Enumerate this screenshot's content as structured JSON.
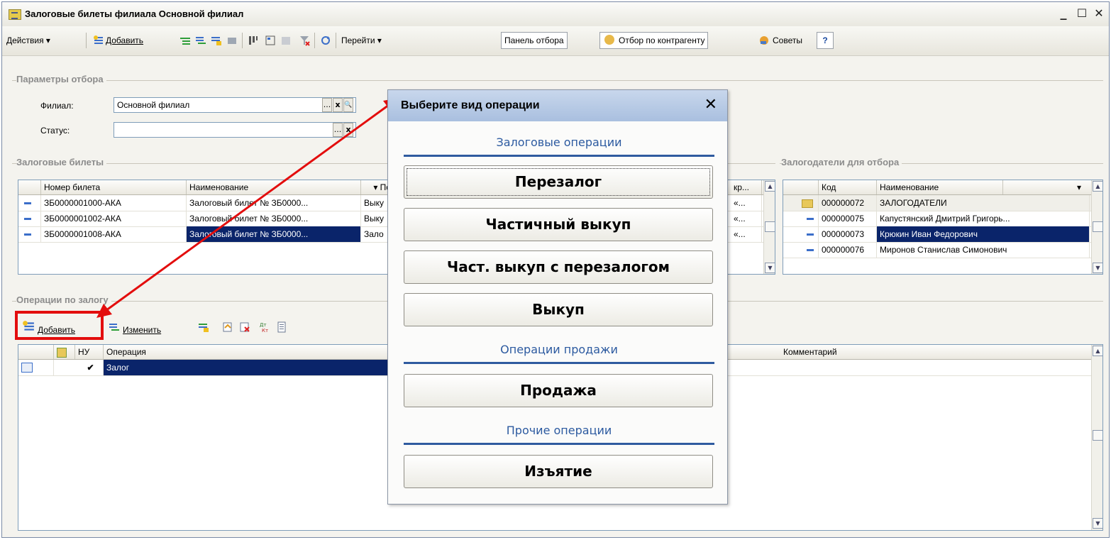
{
  "window": {
    "title": "Залоговые билеты филиала Основной филиал",
    "min": "_",
    "max": "☐",
    "close": "✕"
  },
  "toolbar": {
    "actions": "Действия ▾",
    "add": "Добавить",
    "goto": "Перейти ▾",
    "filter_panel": "Панель отбора",
    "filter_counterparty": "Отбор по контрагенту",
    "tips": "Советы",
    "help": "?"
  },
  "filter": {
    "group_title": "Параметры отбора",
    "branch_label": "Филиал:",
    "branch_value": "Основной филиал",
    "status_label": "Статус:",
    "status_value": "",
    "btn_dots": "...",
    "btn_x": "x",
    "btn_search": "🔍"
  },
  "tickets": {
    "group_title": "Залоговые билеты",
    "columns": [
      "Номер билета",
      "Наименование",
      "▾ Посл",
      "кр...",
      "^"
    ],
    "rows": [
      {
        "number": "ЗБ0000001000-АКА",
        "name": "Залоговый билет № ЗБ0000...",
        "last": "Выку",
        "extra": "«..."
      },
      {
        "number": "ЗБ0000001002-АКА",
        "name": "Залоговый билет № ЗБ0000...",
        "last": "Выку",
        "extra": "«..."
      },
      {
        "number": "ЗБ0000001008-АКА",
        "name": "Залоговый билет № ЗБ0000...",
        "last": "Зало",
        "extra": "«..."
      }
    ]
  },
  "pledgers": {
    "group_title": "Залогодатели для отбора",
    "columns": [
      "Код",
      "Наименование",
      "▾"
    ],
    "rows": [
      {
        "code": "000000072",
        "name": "ЗАЛОГОДАТЕЛИ"
      },
      {
        "code": "000000075",
        "name": "Капустянский Дмитрий Григорь..."
      },
      {
        "code": "000000073",
        "name": "Крюкин Иван Федорович"
      },
      {
        "code": "000000076",
        "name": "Миронов Станислав Симонович"
      }
    ]
  },
  "operations": {
    "group_title": "Операции по залогу",
    "add": "Добавить",
    "edit": "Изменить",
    "columns": [
      "НУ",
      "Операция",
      "Комментарий"
    ],
    "rows": [
      {
        "nu": "✔",
        "operation": "Залог",
        "comment": ""
      }
    ]
  },
  "dialog": {
    "title": "Выберите вид операции",
    "close": "✕",
    "section_pledge": "Залоговые операции",
    "btn_repledge": "Перезалог",
    "btn_partial": "Частичный выкуп",
    "btn_partial_repledge": "Част. выкуп с перезалогом",
    "btn_buyout": "Выкуп",
    "section_sale": "Операции продажи",
    "btn_sale": "Продажа",
    "section_other": "Прочие операции",
    "btn_seizure": "Изъятие"
  },
  "colors": {
    "highlight": "#e30d0d",
    "selection": "#0a246a",
    "section": "#2c5aa0"
  }
}
